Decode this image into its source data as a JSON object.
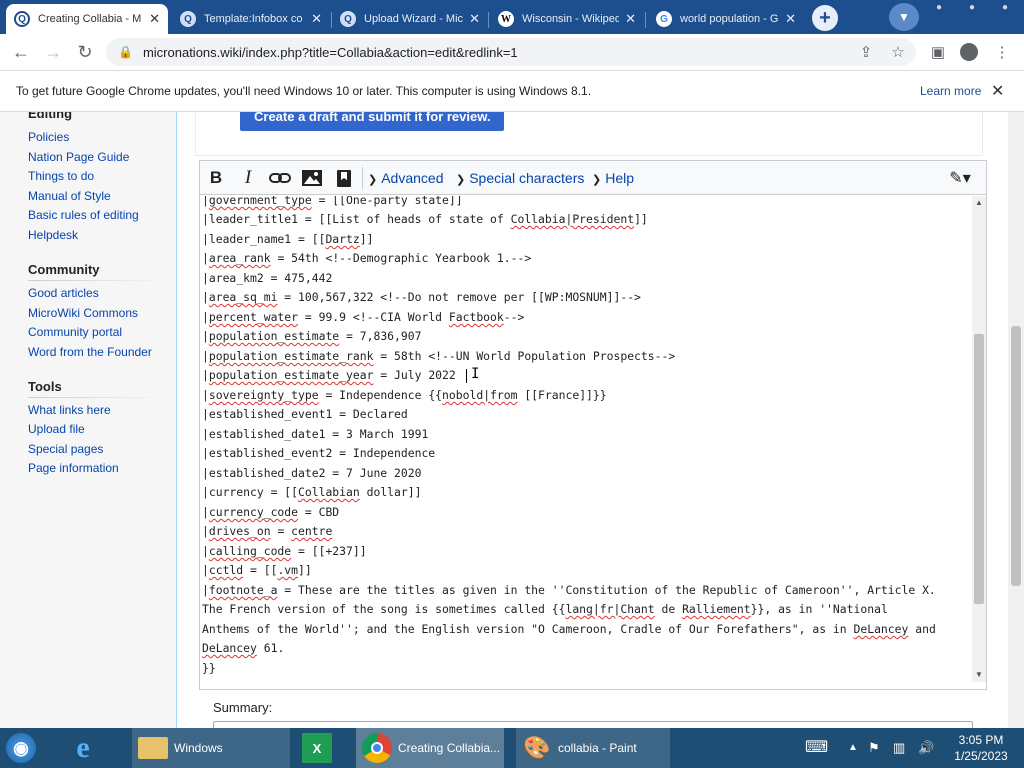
{
  "browser": {
    "tabs": [
      {
        "title": "Creating Collabia - M",
        "favicon": "wiki-search-icon",
        "active": true
      },
      {
        "title": "Template:Infobox co",
        "favicon": "wiki-search-icon",
        "active": false
      },
      {
        "title": "Upload Wizard - Mic",
        "favicon": "wiki-search-icon",
        "active": false
      },
      {
        "title": "Wisconsin - Wikiped",
        "favicon": "wikipedia-icon",
        "active": false
      },
      {
        "title": "world population - G",
        "favicon": "google-icon",
        "active": false
      }
    ],
    "new_tab_label": "+",
    "url": "micronations.wiki/index.php?title=Collabia&action=edit&redlink=1"
  },
  "infobar": {
    "message": "To get future Google Chrome updates, you'll need Windows 10 or later. This computer is using Windows 8.1.",
    "learn_more": "Learn more"
  },
  "sidebar": {
    "editing_heading": "Editing",
    "editing_links": [
      "Policies",
      "Nation Page Guide",
      "Things to do",
      "Manual of Style",
      "Basic rules of editing",
      "Helpdesk"
    ],
    "community_heading": "Community",
    "community_links": [
      "Good articles",
      "MicroWiki Commons",
      "Community portal",
      "Word from the Founder"
    ],
    "tools_heading": "Tools",
    "tools_links": [
      "What links here",
      "Upload file",
      "Special pages",
      "Page information"
    ]
  },
  "draft": {
    "button_label": "Create a draft and submit it for review."
  },
  "editor": {
    "tools": [
      "bold-icon",
      "italic-icon",
      "link-icon",
      "image-icon",
      "reference-icon"
    ],
    "bold_label": "B",
    "italic_label": "I",
    "sections": [
      "Advanced",
      "Special characters",
      "Help"
    ],
    "lines": [
      "|government_type = [[One-party state]]",
      "|leader_title1 = [[List of heads of state of Collabia|President]]",
      "|leader_name1 = [[Dartz]]",
      "|area_rank = 54th <!--Demographic Yearbook 1.-->",
      "|area_km2 = 475,442",
      "|area_sq_mi = 100,567,322 <!--Do not remove per [[WP:MOSNUM]]-->",
      "|percent_water = 99.9 <!--CIA World Factbook-->",
      "|population_estimate = 7,836,907",
      "|population_estimate_rank = 58th <!--UN World Population Prospects-->",
      "|population_estimate_year = July 2022",
      "|sovereignty_type = Independence {{nobold|from [[France]]}}",
      "|established_event1 = Declared",
      "|established_date1 = 3 March 1991",
      "|established_event2 = Independence",
      "|established_date2 = 7 June 2020",
      "|currency = [[Collabian dollar]]",
      "|currency_code = CBD",
      "|drives_on = centre",
      "|calling_code = [[+237]]",
      "|cctld = [[.vm]]",
      "|footnote_a = These are the titles as given in the ''Constitution of the Republic of Cameroon'', Article X.",
      "The French version of the song is sometimes called {{lang|fr|Chant de Ralliement}}, as in ''National",
      "Anthems of the World''; and the English version \"O Cameroon, Cradle of Our Forefathers\", as in DeLancey and",
      "DeLancey 61.",
      "}}"
    ],
    "summary_label": "Summary:"
  },
  "taskbar": {
    "items": [
      "Windows",
      "Creating Collabia...",
      "collabia - Paint"
    ],
    "time": "3:05 PM",
    "date": "1/25/2023"
  },
  "colors": {
    "chrome_frame": "#1d4f8e",
    "link": "#0645ad",
    "draft_button": "#3366cc",
    "taskbar": "#1f4e74"
  }
}
